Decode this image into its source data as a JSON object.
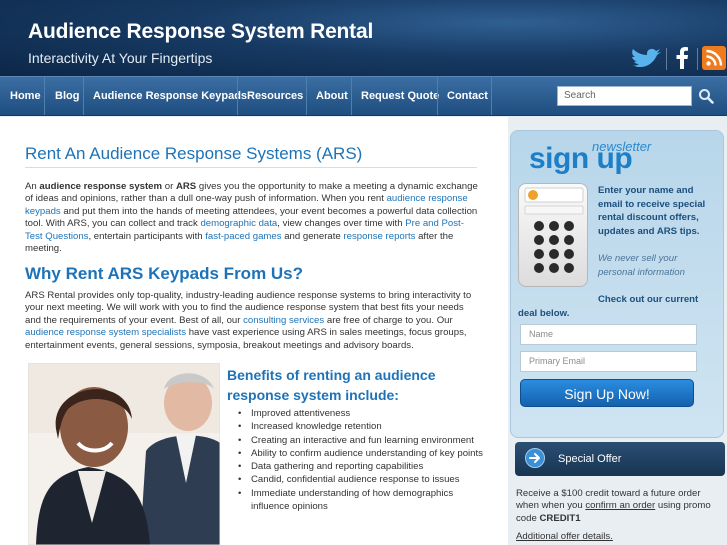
{
  "header": {
    "title": "Audience Response System Rental",
    "tagline": "Interactivity At Your Fingertips",
    "social": [
      "twitter-icon",
      "facebook-icon",
      "rss-icon"
    ],
    "colors": {
      "background": "#173a63",
      "accent": "#1e73b8",
      "rss": "#f07b1c"
    }
  },
  "nav": {
    "items": [
      {
        "label": "Home"
      },
      {
        "label": "Blog"
      },
      {
        "label": "Audience Response Keypads"
      },
      {
        "label": "Resources"
      },
      {
        "label": "About"
      },
      {
        "label": "Request Quote"
      },
      {
        "label": "Contact"
      }
    ],
    "search_placeholder": "Search"
  },
  "main": {
    "title": "Rent An Audience Response Systems (ARS)",
    "intro": {
      "p1": "An ",
      "b1": "audience response system",
      "p2": " or ",
      "b2": "ARS",
      "p3": " gives you the opportunity to make a meeting a dynamic exchange of ideas and opinions, rather than a dull one-way push of information. When you rent ",
      "l1": "audience response keypads",
      "p4": " and put them into the hands of meeting attendees, your event becomes a powerful data collection tool. With ARS, you can collect and track ",
      "l2": "demographic data",
      "p5": ", view changes over time with ",
      "l3": "Pre and Post-Test Questions",
      "p6": ", entertain participants with ",
      "l4": "fast-paced games",
      "p7": " and generate ",
      "l5": "response reports",
      "p8": " after the meeting."
    },
    "why_title": "Why Rent ARS Keypads From Us?",
    "why": {
      "p1": "ARS Rental provides only top-quality, industry-leading audience response systems to bring interactivity to your next meeting. We will work with you to find the audience response system that best fits your needs and the requirements of your event. Best of all, our ",
      "l1": "consulting services",
      "p2": " are free of charge to you. Our ",
      "l2": "audience response system specialists",
      "p3": " have vast experience using ARS in sales meetings, focus groups, entertainment events, general sessions, symposia, breakout meetings and advisory boards."
    },
    "benefits_title": "Benefits of renting an audience response system include:",
    "benefits": [
      "Improved attentiveness",
      "Increased knowledge retention",
      "Creating an interactive and fun learning environment",
      "Ability to confirm audience understanding of key points",
      "Data gathering and reporting capabilities",
      "Candid, confidential audience response to issues",
      "Immediate understanding of how demographics influence opinions"
    ]
  },
  "sidebar": {
    "newsletter_small": "newsletter",
    "newsletter_big": "sign up",
    "cta": "Enter your name and email to receive special rental discount offers, updates and ARS tips.",
    "privacy": "We never sell your personal information",
    "check_offer": "Check out our current deal below.",
    "name_placeholder": "Name",
    "email_placeholder": "Primary Email",
    "signup_button": "Sign Up Now!",
    "special_offer": {
      "title": "Special Offer",
      "t1": "Receive a $100 credit toward a future order when when you ",
      "link": "confirm an order",
      "t2": " using promo code ",
      "code": "CREDIT1",
      "details": "Additional offer details."
    }
  }
}
